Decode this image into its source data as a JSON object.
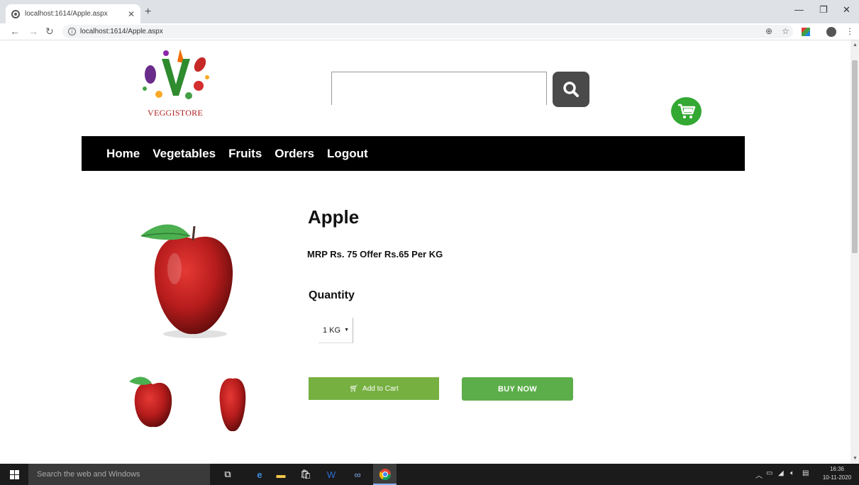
{
  "browser": {
    "tab_title": "localhost:1614/Apple.aspx",
    "url": "localhost:1614/Apple.aspx"
  },
  "site": {
    "logo_text": "VEGGISTORE",
    "search_placeholder": "",
    "nav": [
      "Home",
      "Vegetables",
      "Fruits",
      "Orders",
      "Logout"
    ]
  },
  "product": {
    "name": "Apple",
    "price_text": "MRP Rs. 75 Offer Rs.65 Per KG",
    "quantity_label": "Quantity",
    "quantity_selected": "1 KG",
    "add_to_cart_label": "Add to Cart",
    "buy_now_label": "BUY NOW"
  },
  "taskbar": {
    "search_placeholder": "Search the web and Windows",
    "time": "16:36",
    "date": "10-11-2020"
  },
  "colors": {
    "nav_bg": "#000000",
    "add_cart_green": "#76b041",
    "buy_now_green": "#5cae4a",
    "cart_icon_green": "#33a833",
    "search_btn": "#4a4a4a"
  }
}
